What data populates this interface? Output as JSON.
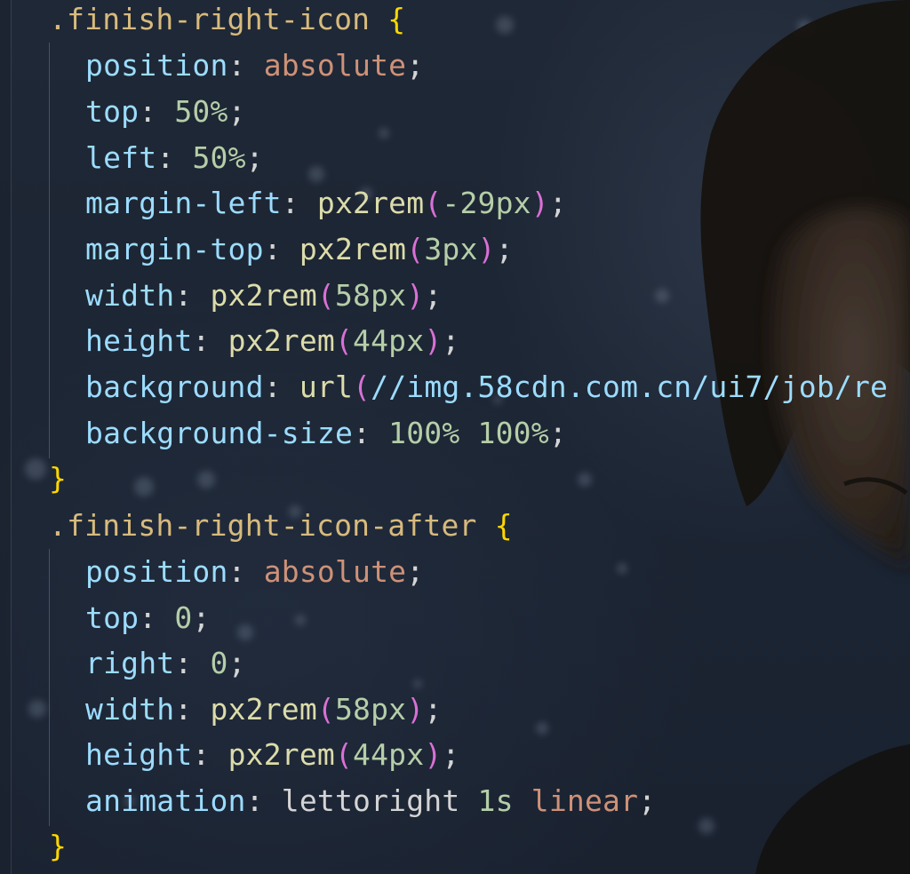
{
  "colors": {
    "background": "#1c2533",
    "selector": "#d7ba7d",
    "brace": "#ffd700",
    "property": "#9cdcfe",
    "keyword_value": "#ce9178",
    "number": "#b5cea8",
    "function": "#dcdcaa",
    "paren": "#da70d6",
    "punctuation": "#d4d4d4"
  },
  "code": {
    "rule1": {
      "selector": ".finish-right-icon",
      "open_brace": "{",
      "close_brace": "}",
      "decl_position": {
        "prop": "position",
        "value": "absolute"
      },
      "decl_top": {
        "prop": "top",
        "value": "50%"
      },
      "decl_left": {
        "prop": "left",
        "value": "50%"
      },
      "decl_margin_left": {
        "prop": "margin-left",
        "fn": "px2rem",
        "arg": "-29px"
      },
      "decl_margin_top": {
        "prop": "margin-top",
        "fn": "px2rem",
        "arg": "3px"
      },
      "decl_width": {
        "prop": "width",
        "fn": "px2rem",
        "arg": "58px"
      },
      "decl_height": {
        "prop": "height",
        "fn": "px2rem",
        "arg": "44px"
      },
      "decl_background": {
        "prop": "background",
        "fn": "url",
        "arg": "//img.58cdn.com.cn/ui7/job/re"
      },
      "decl_background_size": {
        "prop": "background-size",
        "value1": "100%",
        "value2": "100%"
      }
    },
    "rule2": {
      "selector": ".finish-right-icon-after",
      "open_brace": "{",
      "close_brace": "}",
      "decl_position": {
        "prop": "position",
        "value": "absolute"
      },
      "decl_top": {
        "prop": "top",
        "value": "0"
      },
      "decl_right": {
        "prop": "right",
        "value": "0"
      },
      "decl_width": {
        "prop": "width",
        "fn": "px2rem",
        "arg": "58px"
      },
      "decl_height": {
        "prop": "height",
        "fn": "px2rem",
        "arg": "44px"
      },
      "decl_animation": {
        "prop": "animation",
        "name": "lettoright",
        "duration": "1s",
        "timing": "linear"
      }
    }
  },
  "punct": {
    "colon": ":",
    "semicolon": ";",
    "open_paren": "(",
    "close_paren": ")"
  }
}
